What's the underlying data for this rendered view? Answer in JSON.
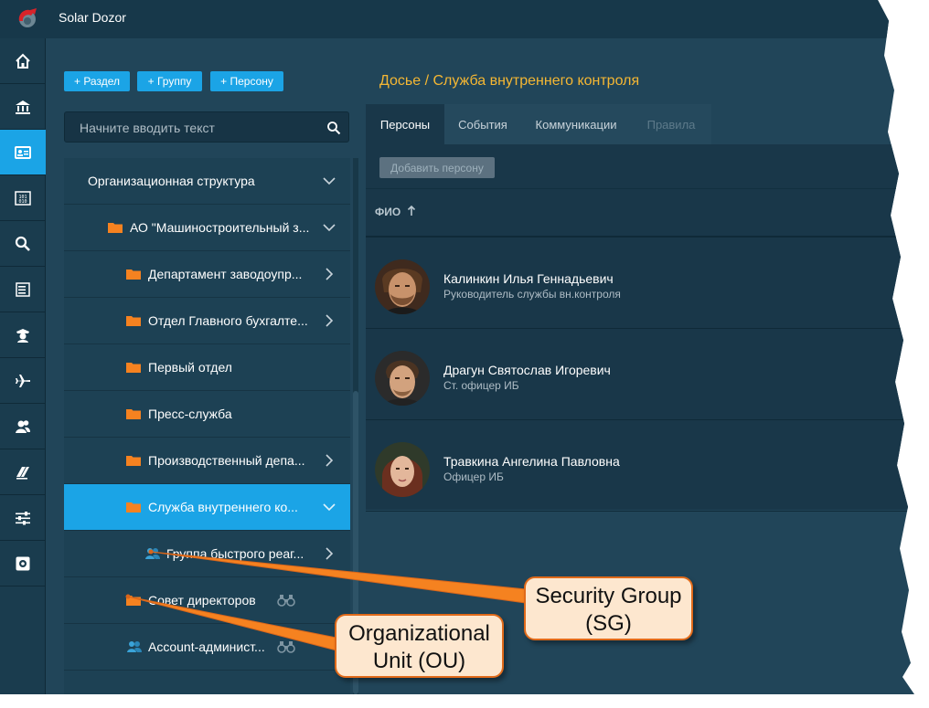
{
  "app": {
    "title": "Solar Dozor"
  },
  "nav": {
    "items": [
      {
        "name": "home-icon"
      },
      {
        "name": "bank-icon"
      },
      {
        "name": "dossier-icon",
        "active": true
      },
      {
        "name": "binary-icon"
      },
      {
        "name": "search-icon"
      },
      {
        "name": "list-icon"
      },
      {
        "name": "police-icon"
      },
      {
        "name": "plane-icon"
      },
      {
        "name": "users-icon"
      },
      {
        "name": "books-icon"
      },
      {
        "name": "sliders-icon"
      },
      {
        "name": "settings-icon"
      }
    ]
  },
  "actions": {
    "add_section": "+ Раздел",
    "add_group": "+ Группу",
    "add_person": "+ Персону"
  },
  "search": {
    "placeholder": "Начните вводить текст"
  },
  "tree": {
    "items": [
      {
        "label": "Организационная структура",
        "icon": "none",
        "chevron": "down"
      },
      {
        "label": "АО \"Машиностроительный з...",
        "icon": "folder",
        "chevron": "down"
      },
      {
        "label": "Департамент заводоупр...",
        "icon": "folder",
        "chevron": "right"
      },
      {
        "label": "Отдел Главного бухгалте...",
        "icon": "folder",
        "chevron": "right"
      },
      {
        "label": "Первый отдел",
        "icon": "folder",
        "chevron": "none"
      },
      {
        "label": "Пресс-служба",
        "icon": "folder",
        "chevron": "none"
      },
      {
        "label": "Производственный депа...",
        "icon": "folder",
        "chevron": "right"
      },
      {
        "label": "Служба внутреннего ко...",
        "icon": "folder",
        "chevron": "down",
        "selected": true
      },
      {
        "label": "Группа быстрого реаг...",
        "icon": "group",
        "chevron": "right"
      },
      {
        "label": "Совет директоров",
        "icon": "folder",
        "chevron": "binoculars"
      },
      {
        "label": "Account-админист...",
        "icon": "group",
        "chevron": "binoculars"
      }
    ]
  },
  "main": {
    "breadcrumb": "Досье / Служба внутреннего контроля",
    "tabs": [
      {
        "label": "Персоны",
        "state": "active"
      },
      {
        "label": "События",
        "state": "normal"
      },
      {
        "label": "Коммуникации",
        "state": "normal"
      },
      {
        "label": "Правила",
        "state": "disabled"
      }
    ],
    "add_person_button": "Добавить персону",
    "column_header": "ФИО",
    "persons": [
      {
        "name": "Калинкин Илья Геннадьевич",
        "role": "Руководитель службы вн.контроля"
      },
      {
        "name": "Драгун Святослав Игоревич",
        "role": "Ст. офицер ИБ"
      },
      {
        "name": "Травкина Ангелина Павловна",
        "role": "Офицер ИБ"
      }
    ]
  },
  "callouts": {
    "security_group": {
      "line1": "Security Group",
      "line2": "(SG)"
    },
    "organizational_unit": {
      "line1": "Organizational",
      "line2": "Unit (OU)"
    }
  },
  "colors": {
    "accent": "#1ba4e6",
    "breadcrumb": "#f5b733",
    "folder": "#f58220",
    "callout_border": "#e06a1a",
    "callout_fill": "#fde7cf"
  }
}
